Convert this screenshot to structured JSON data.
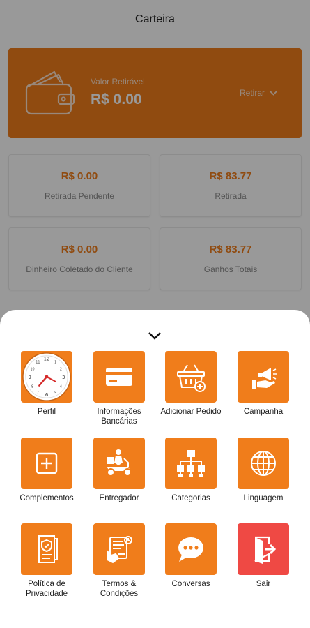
{
  "header": {
    "title": "Carteira"
  },
  "wallet": {
    "label": "Valor Retirável",
    "amount": "R$ 0.00",
    "withdraw_label": "Retirar"
  },
  "stats": [
    {
      "value": "R$ 0.00",
      "label": "Retirada Pendente"
    },
    {
      "value": "R$ 83.77",
      "label": "Retirada"
    },
    {
      "value": "R$ 0.00",
      "label": "Dinheiro Coletado do Cliente"
    },
    {
      "value": "R$ 83.77",
      "label": "Ganhos Totais"
    }
  ],
  "menu": {
    "items": [
      {
        "label": "Perfil",
        "icon": "clock-icon"
      },
      {
        "label": "Informações Bancárias",
        "icon": "credit-card-icon"
      },
      {
        "label": "Adicionar Pedido",
        "icon": "basket-add-icon"
      },
      {
        "label": "Campanha",
        "icon": "campaign-icon"
      },
      {
        "label": "Complementos",
        "icon": "plus-square-icon"
      },
      {
        "label": "Entregador",
        "icon": "delivery-scooter-icon"
      },
      {
        "label": "Categorias",
        "icon": "hierarchy-icon"
      },
      {
        "label": "Linguagem",
        "icon": "globe-icon"
      },
      {
        "label": "Política de Privacidade",
        "icon": "privacy-shield-icon"
      },
      {
        "label": "Termos & Condições",
        "icon": "terms-contract-icon"
      },
      {
        "label": "Conversas",
        "icon": "chat-bubble-icon"
      },
      {
        "label": "Sair",
        "icon": "logout-door-icon"
      }
    ]
  },
  "colors": {
    "accent": "#f07d1b",
    "danger": "#ef4944",
    "overlay": "rgba(0,0,0,0.40)"
  }
}
